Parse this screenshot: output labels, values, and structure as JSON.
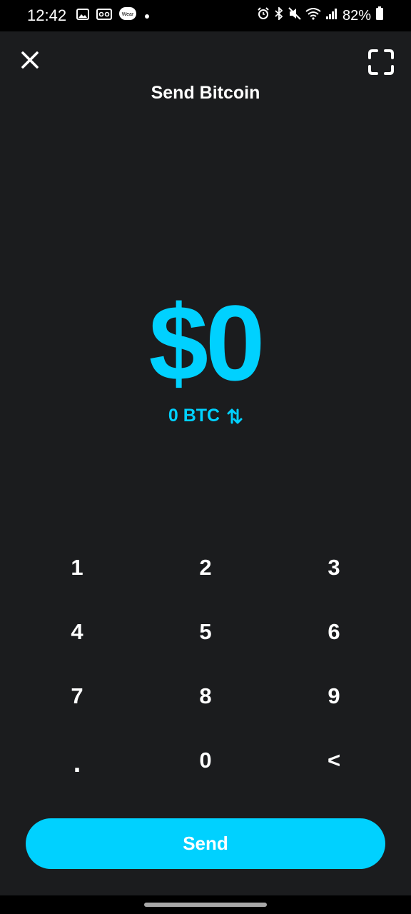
{
  "status_bar": {
    "time": "12:42",
    "battery_percent": "82%",
    "left_icons": [
      "gallery-icon",
      "voicemail-icon",
      "wear-icon",
      "dot-icon"
    ],
    "wear_label": "Wear",
    "right_icons": [
      "alarm-icon",
      "bluetooth-icon",
      "mute-icon",
      "wifi-icon",
      "signal-icon",
      "battery-icon"
    ]
  },
  "header": {
    "title": "Send Bitcoin",
    "close_icon": "close-icon",
    "scan_icon": "scan-icon"
  },
  "amount": {
    "fiat": "$0",
    "btc": "0 BTC",
    "toggle_icon": "swap-arrows-icon",
    "accent_color": "#00d1ff"
  },
  "keypad": {
    "keys": [
      "1",
      "2",
      "3",
      "4",
      "5",
      "6",
      "7",
      "8",
      "9",
      ".",
      "0",
      "<"
    ]
  },
  "send_button": {
    "label": "Send"
  },
  "colors": {
    "background": "#1b1c1e",
    "accent": "#00d1ff",
    "text": "#ffffff"
  }
}
